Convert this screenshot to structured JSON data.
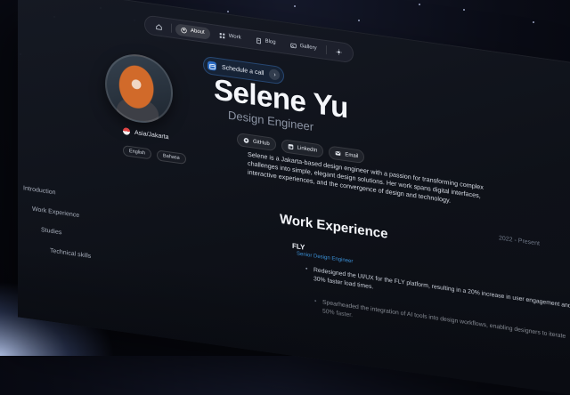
{
  "nav": {
    "items": [
      {
        "label": "",
        "icon": "home-icon"
      },
      {
        "label": "About",
        "icon": "user-icon",
        "active": true
      },
      {
        "label": "Work",
        "icon": "grid-icon"
      },
      {
        "label": "Blog",
        "icon": "book-icon"
      },
      {
        "label": "Gallery",
        "icon": "gallery-icon"
      }
    ],
    "theme_icon": "sun-icon"
  },
  "profile": {
    "location": "Asia/Jakarta",
    "languages": [
      "English",
      "Bahasa"
    ]
  },
  "hero": {
    "schedule_label": "Schedule a call",
    "name": "Selene Yu",
    "role": "Design Engineer",
    "social": [
      "GitHub",
      "LinkedIn",
      "Email"
    ],
    "bio": "Selene is a Jakarta-based design engineer with a passion for transforming complex challenges into simple, elegant design solutions. Her work spans digital interfaces, interactive experiences, and the convergence of design and technology."
  },
  "toc": [
    "Introduction",
    "Work Experience",
    "Studies",
    "Technical skills"
  ],
  "work": {
    "title": "Work Experience",
    "company": "FLY",
    "date": "2022 - Present",
    "role": "Senior Design Engineer",
    "bullets": [
      "Redesigned the UI/UX for the FLY platform, resulting in a 20% increase in user engagement and 30% faster load times.",
      "Spearheaded the integration of AI tools into design workflows, enabling designers to iterate 50% faster."
    ]
  },
  "colors": {
    "accent": "#3b8fd6",
    "schedule_bg": "#2b6cc4"
  }
}
